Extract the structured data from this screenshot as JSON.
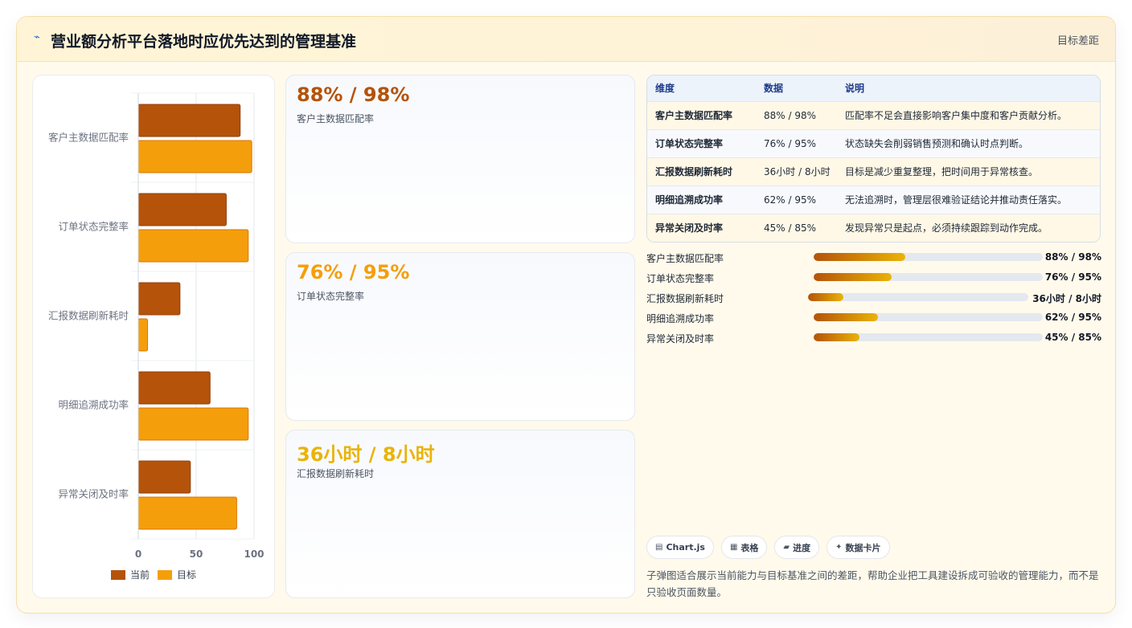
{
  "header": {
    "title": "营业额分析平台落地时应优先达到的管理基准",
    "icon": "sparkle-icon",
    "link": "目标差距"
  },
  "colors": {
    "current": "#b45309",
    "target": "#f59e0b",
    "stat1": "#b45309",
    "stat2": "#f59e0b",
    "stat3": "#eab308"
  },
  "chart_data": {
    "type": "bar",
    "orientation": "horizontal",
    "categories": [
      "客户主数据匹配率",
      "订单状态完整率",
      "汇报数据刷新耗时",
      "明细追溯成功率",
      "异常关闭及时率"
    ],
    "series": [
      {
        "name": "当前",
        "values": [
          88,
          76,
          36,
          62,
          45
        ]
      },
      {
        "name": "目标",
        "values": [
          98,
          95,
          8,
          95,
          85
        ]
      }
    ],
    "xlim": [
      0,
      100
    ],
    "xticks": [
      "0",
      "50",
      "100"
    ],
    "grid": true,
    "legend": "bottom"
  },
  "stats": [
    {
      "value": "88% / 98%",
      "label": "客户主数据匹配率"
    },
    {
      "value": "76% / 95%",
      "label": "订单状态完整率"
    },
    {
      "value": "36小时 / 8小时",
      "label": "汇报数据刷新耗时"
    }
  ],
  "table": {
    "headers": [
      "维度",
      "数据",
      "说明"
    ],
    "rows": [
      [
        "客户主数据匹配率",
        "88% / 98%",
        "匹配率不足会直接影响客户集中度和客户贡献分析。"
      ],
      [
        "订单状态完整率",
        "76% / 95%",
        "状态缺失会削弱销售预测和确认时点判断。"
      ],
      [
        "汇报数据刷新耗时",
        "36小时 / 8小时",
        "目标是减少重复整理，把时间用于异常核查。"
      ],
      [
        "明细追溯成功率",
        "62% / 95%",
        "无法追溯时，管理层很难验证结论并推动责任落实。"
      ],
      [
        "异常关闭及时率",
        "45% / 85%",
        "发现异常只是起点，必须持续跟踪到动作完成。"
      ]
    ]
  },
  "progress": [
    {
      "label": "客户主数据匹配率",
      "value": "88% / 98%",
      "fill": 0.4
    },
    {
      "label": "订单状态完整率",
      "value": "76% / 95%",
      "fill": 0.34
    },
    {
      "label": "汇报数据刷新耗时",
      "value": "36小时 / 8小时",
      "fill": 0.16
    },
    {
      "label": "明细追溯成功率",
      "value": "62% / 95%",
      "fill": 0.28
    },
    {
      "label": "异常关闭及时率",
      "value": "45% / 85%",
      "fill": 0.2
    }
  ],
  "chips": [
    {
      "icon": "chart-icon",
      "glyph": "▤",
      "label": "Chart.js"
    },
    {
      "icon": "table-icon",
      "glyph": "▦",
      "label": "表格"
    },
    {
      "icon": "progress-icon",
      "glyph": "▰",
      "label": "进度"
    },
    {
      "icon": "sparkle-icon",
      "glyph": "✦",
      "label": "数据卡片"
    }
  ],
  "note": "子弹图适合展示当前能力与目标基准之间的差距，帮助企业把工具建设拆成可验收的管理能力，而不是只验收页面数量。"
}
